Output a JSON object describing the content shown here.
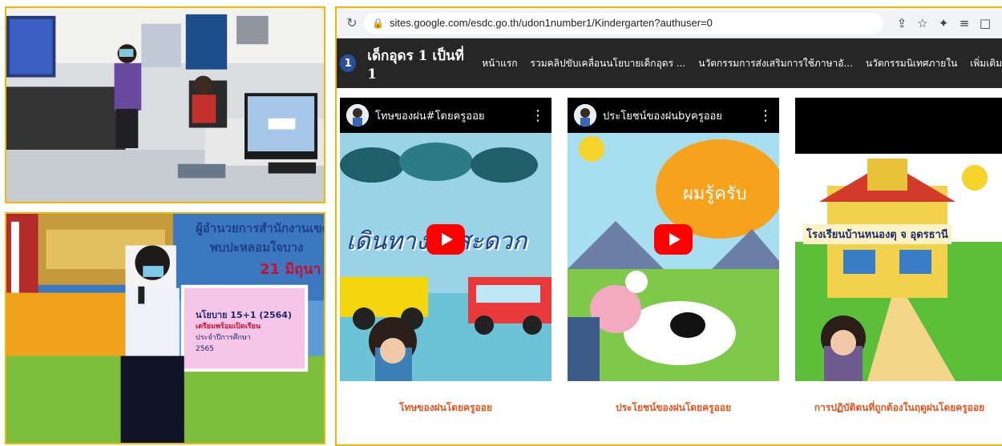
{
  "browser": {
    "url": "sites.google.com/esdc.go.th/udon1number1/Kindergarten?authuser=0",
    "icons": [
      "reload-icon",
      "lock-icon",
      "share-icon",
      "star-icon",
      "extension-icon",
      "menu-icon",
      "window-icon"
    ]
  },
  "site": {
    "logo_text": "1",
    "title": "เด็กอุดร 1 เป็นที่ 1",
    "nav": [
      "หน้าแรก",
      "รวมคลิปขับเคลื่อนนโยบายเด็กอุดร ...",
      "นวัตกรรมการส่งเสริมการใช้ภาษาอั...",
      "นวัตกรรมนิเทศภายใน",
      "เพิ่มเติม"
    ]
  },
  "videos": [
    {
      "title": "โทษของฝน#โดยครูออย",
      "overlay": "เดินทางไม่สะดวก",
      "caption": "โทษของฝนโดยครูออย"
    },
    {
      "title": "ประโยชน์ของฝนbyครูออย",
      "overlay": "ผมรู้ครับ",
      "caption": "ประโยชน์ของฝนโดยครูออย"
    },
    {
      "title": "",
      "overlay": "โรงเรียนบ้านหนองตุ จ อุดรธานี",
      "caption": "การปฏิบัติตนที่ถูกต้องในฤดูฝนโดยครูออย"
    }
  ],
  "photo2": {
    "banner": "ผู้อำนวยการสำนักงานเขตพื้น",
    "banner2": "พบปะหลอมใจบาง",
    "date": "21 มิถุนา",
    "poster_lines": [
      "นโยบาย 15+1 (2564)",
      "เตรียมพร้อมเปิดเรียน",
      "ประจำปีการศึกษา",
      "2565"
    ]
  },
  "colors": {
    "border": "#f2b705",
    "caption": "#e8541e",
    "sitebar": "#262626",
    "play": "#ff0000"
  }
}
